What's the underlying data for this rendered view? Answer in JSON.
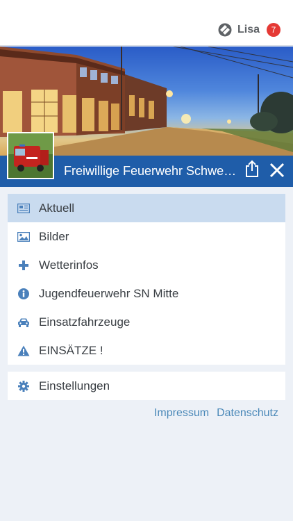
{
  "header": {
    "user_name": "Lisa",
    "notification_count": "7",
    "user_icon": "app-logo-icon"
  },
  "site": {
    "title": "Freiwillige Feuerwehr Schwerin Mitte",
    "share_icon": "share-icon",
    "close_icon": "close-icon"
  },
  "menu": {
    "items": [
      {
        "label": "Aktuell",
        "icon": "news-icon",
        "active": true
      },
      {
        "label": "Bilder",
        "icon": "image-icon",
        "active": false
      },
      {
        "label": "Wetterinfos",
        "icon": "plus-icon",
        "active": false
      },
      {
        "label": "Jugendfeuerwehr SN Mitte",
        "icon": "info-icon",
        "active": false
      },
      {
        "label": "Einsatzfahrzeuge",
        "icon": "car-icon",
        "active": false
      },
      {
        "label": "EINSÄTZE !",
        "icon": "warning-icon",
        "active": false
      }
    ],
    "settings": {
      "label": "Einstellungen",
      "icon": "gear-icon"
    }
  },
  "footer": {
    "links": [
      "Impressum",
      "Datenschutz"
    ]
  },
  "colors": {
    "accent": "#1f5da9",
    "active_row": "#c9dbef",
    "icon": "#4a80bb",
    "badge": "#e53935",
    "link": "#4a88b8"
  }
}
